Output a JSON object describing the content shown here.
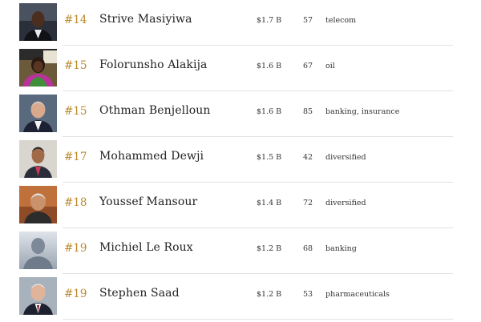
{
  "rows": [
    {
      "rank": "#14",
      "name": "Strive Masiyiwa",
      "net_worth": "$1.7 B",
      "age": "57",
      "source": "telecom",
      "photo": "portrait-dark-suit"
    },
    {
      "rank": "#15",
      "name": "Folorunsho Alakija",
      "net_worth": "$1.6 B",
      "age": "67",
      "source": "oil",
      "photo": "portrait-colorful-dress"
    },
    {
      "rank": "#15",
      "name": "Othman Benjelloun",
      "net_worth": "$1.6 B",
      "age": "85",
      "source": "banking, insurance",
      "photo": "portrait-gray-hair-suit"
    },
    {
      "rank": "#17",
      "name": "Mohammed Dewji",
      "net_worth": "$1.5 B",
      "age": "42",
      "source": "diversified",
      "photo": "portrait-light-background"
    },
    {
      "rank": "#18",
      "name": "Youssef Mansour",
      "net_worth": "$1.4 B",
      "age": "72",
      "source": "diversified",
      "photo": "portrait-warm-background"
    },
    {
      "rank": "#19",
      "name": "Michiel Le Roux",
      "net_worth": "$1.2 B",
      "age": "68",
      "source": "banking",
      "photo": "placeholder-silhouette"
    },
    {
      "rank": "#19",
      "name": "Stephen Saad",
      "net_worth": "$1.2 B",
      "age": "53",
      "source": "pharmaceuticals",
      "photo": "portrait-white-hair-suit"
    }
  ],
  "colors": {
    "rank": "#b8892b",
    "separator": "#e3e3e3",
    "text": "#222222"
  }
}
